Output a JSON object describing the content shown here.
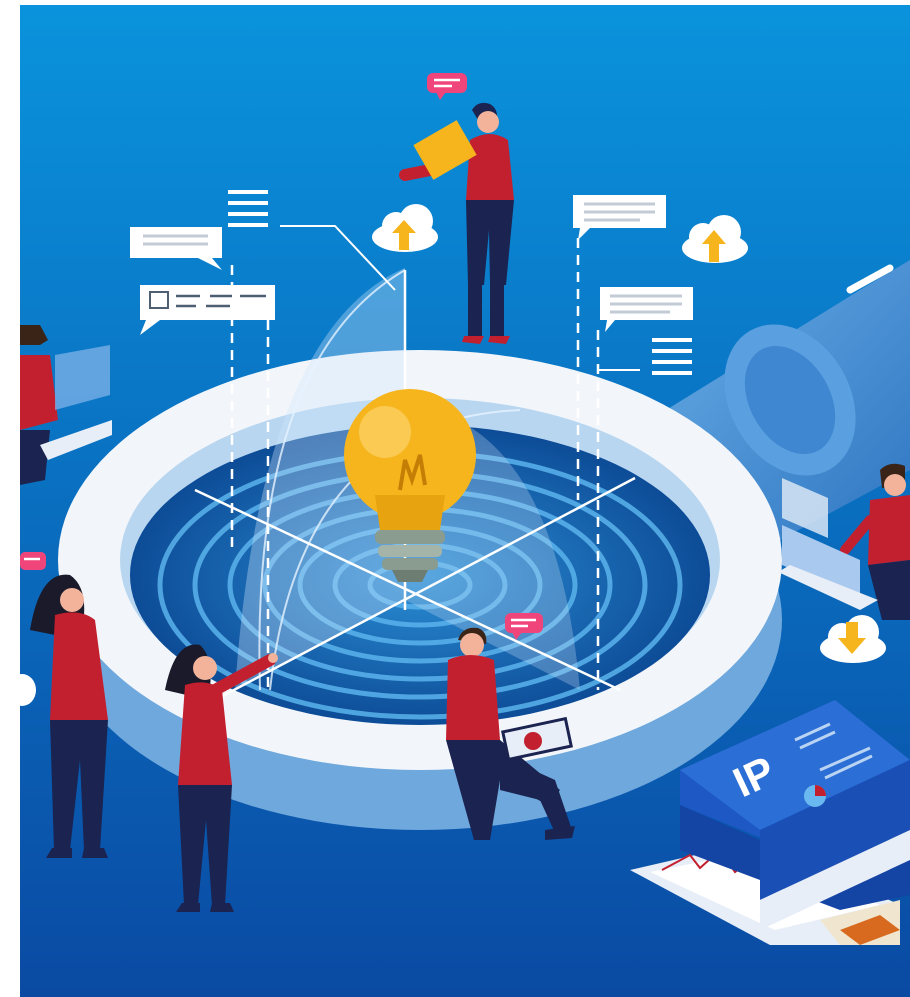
{
  "illustration": {
    "book_cover_text": "IP",
    "colors": {
      "background_top": "#0a8fd9",
      "background_bottom": "#0a4fa8",
      "accent_red": "#c3202f",
      "navy": "#1b2350",
      "bulb_yellow": "#f6b51d",
      "ring_white": "#f2f6fb",
      "pool_blue": "#1366b3",
      "speech_pink": "#f0457a"
    },
    "icons": [
      "lightbulb-icon",
      "magnifying-glass-icon",
      "cloud-upload-icon",
      "cloud-download-icon",
      "speech-bubble-icon",
      "document-card-icon",
      "book-icon"
    ]
  }
}
